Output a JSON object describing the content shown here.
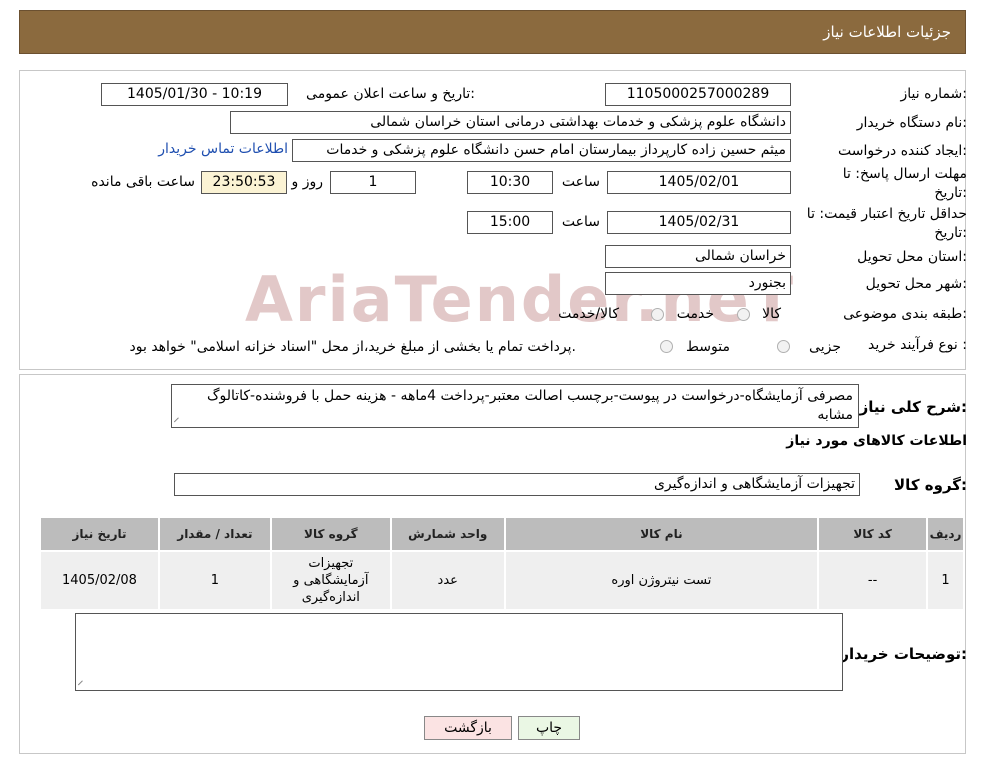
{
  "header": {
    "title": "جزئیات اطلاعات نیاز"
  },
  "form": {
    "need_number_label": "شماره نیاز:",
    "need_number": "1105000257000289",
    "announce_label": "تاریخ و ساعت اعلان عمومی:",
    "announce_value": "1405/01/30 - 10:19",
    "buyer_org_label": "نام دستگاه خریدار:",
    "buyer_org": "دانشگاه علوم پزشکی و خدمات بهداشتی درمانی استان خراسان شمالی",
    "requester_label": "ایجاد کننده درخواست:",
    "requester": "میثم  حسین زاده  کارپرداز بیمارستان امام حسن دانشگاه علوم پزشکی و خدمات",
    "contact_link": "اطلاعات تماس خریدار",
    "deadline_label_1": "مهلت ارسال پاسخ: تا",
    "deadline_label_2": "تاریخ:",
    "deadline_date": "1405/02/01",
    "time_label": "ساعت",
    "deadline_time": "10:30",
    "days_value": "1",
    "days_label": "روز و",
    "countdown": "23:50:53",
    "remaining_label": "ساعت باقی مانده",
    "validity_label_1": "حداقل تاریخ اعتبار قیمت: تا",
    "validity_label_2": "تاریخ:",
    "validity_date": "1405/02/31",
    "validity_time": "15:00",
    "province_label": "استان محل تحویل:",
    "province": "خراسان شمالی",
    "city_label": "شهر محل تحویل:",
    "city": "بجنورد",
    "category_label": "طبقه بندی موضوعی:",
    "category_options": [
      "کالا",
      "خدمت",
      "کالا/خدمت"
    ],
    "process_label": "نوع فرآیند خرید :",
    "process_options": [
      "جزیی",
      "متوسط"
    ],
    "process_note": "پرداخت تمام یا بخشی از مبلغ خرید،از محل \"اسناد خزانه اسلامی\" خواهد بود."
  },
  "watermark": "AriaTender.neT",
  "details": {
    "summary_label": "شرح کلی نیاز:",
    "summary": "مصرفی آزمایشگاه-درخواست در پیوست-برچسب اصالت معتبر-پرداخت 4ماهه - هزینه حمل با فروشنده-کاتالوگ مشابه",
    "goods_info_title": "اطلاعات کالاهای مورد نیاز",
    "goods_group_label": "گروه کالا:",
    "goods_group": "تجهیزات آزمایشگاهی و اندازه‌گیری",
    "table": {
      "headers": [
        "ردیف",
        "کد کالا",
        "نام کالا",
        "واحد شمارش",
        "گروه کالا",
        "تعداد / مقدار",
        "تاریخ نیاز"
      ],
      "rows": [
        [
          "1",
          "--",
          "تست نیتروژن اوره",
          "عدد",
          "تجهیزات آزمایشگاهی و اندازه‌گیری",
          "1",
          "1405/02/08"
        ]
      ]
    },
    "buyer_notes_label": "توضیحات خریدار:",
    "buyer_notes": ""
  },
  "buttons": {
    "print": "چاپ",
    "back": "بازگشت"
  },
  "colors": {
    "header_bg": "#8b6a3e",
    "table_header_bg": "#bcbcbc",
    "countdown_bg": "#fbf3d4",
    "print_bg": "#eaf7e4",
    "back_bg": "#fbe3e3",
    "link": "#1f4fb0"
  }
}
